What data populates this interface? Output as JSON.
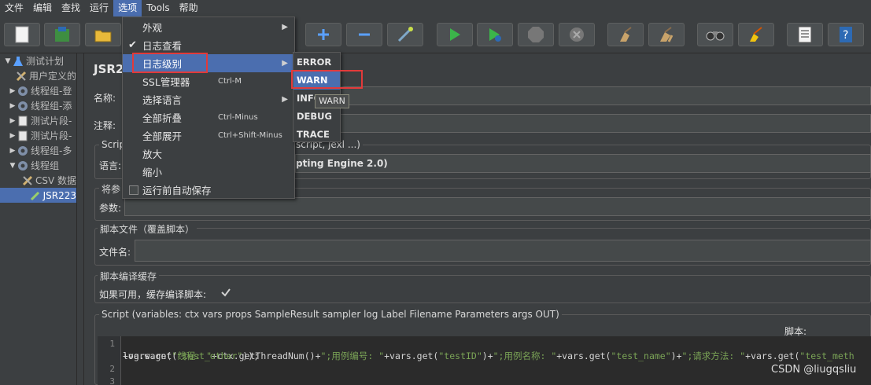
{
  "menubar": {
    "items": [
      "文件",
      "编辑",
      "查找",
      "运行",
      "选项",
      "Tools",
      "帮助"
    ]
  },
  "dropdown": {
    "items": [
      {
        "label": "外观",
        "shortcut": "",
        "submenu": true,
        "check": false
      },
      {
        "label": "日志查看",
        "shortcut": "",
        "submenu": false,
        "check": true
      },
      {
        "label": "日志级别",
        "shortcut": "",
        "submenu": true,
        "check": false
      },
      {
        "label": "SSL管理器",
        "shortcut": "Ctrl-M",
        "submenu": false,
        "check": false
      },
      {
        "label": "选择语言",
        "shortcut": "",
        "submenu": true,
        "check": false
      },
      {
        "label": "全部折叠",
        "shortcut": "Ctrl-Minus",
        "submenu": false,
        "check": false
      },
      {
        "label": "全部展开",
        "shortcut": "Ctrl+Shift-Minus",
        "submenu": false,
        "check": false
      },
      {
        "label": "放大",
        "shortcut": "",
        "submenu": false,
        "check": false
      },
      {
        "label": "缩小",
        "shortcut": "",
        "submenu": false,
        "check": false
      },
      {
        "label": "运行前自动保存",
        "shortcut": "",
        "submenu": false,
        "check": false
      }
    ]
  },
  "submenu": {
    "items": [
      "ERROR",
      "WARN",
      "INFO",
      "DEBUG",
      "TRACE"
    ],
    "tooltip": "WARN"
  },
  "tree": {
    "items": [
      {
        "label": "测试计划",
        "arrow": "▼",
        "icon": "flask"
      },
      {
        "label": "用户定义的",
        "arrow": "",
        "icon": "tools"
      },
      {
        "label": "线程组-登",
        "arrow": "▶",
        "icon": "gear"
      },
      {
        "label": "线程组-添",
        "arrow": "▶",
        "icon": "gear"
      },
      {
        "label": "测试片段-",
        "arrow": "▶",
        "icon": "doc"
      },
      {
        "label": "测试片段-",
        "arrow": "▶",
        "icon": "doc"
      },
      {
        "label": "线程组-多",
        "arrow": "▶",
        "icon": "gear"
      },
      {
        "label": "线程组",
        "arrow": "▼",
        "icon": "gear"
      },
      {
        "label": "CSV 数据",
        "arrow": "",
        "icon": "tools"
      },
      {
        "label": "JSR223",
        "arrow": "",
        "icon": "pen"
      }
    ]
  },
  "main": {
    "title": "JSR2",
    "name_label": "名称:",
    "comment_label": "注释:",
    "script_group_title": "Scrip",
    "script_group_title_right": "script, jexl ...)",
    "language_label": "语言:",
    "language_value": "pting Engine 2.0)",
    "params_group_title": "将参",
    "params_label": "参数:",
    "file_group_title": "脚本文件（覆盖脚本）",
    "file_label": "文件名:",
    "cache_group_title": "脚本编译缓存",
    "cache_label": "如果可用，缓存编译脚本:",
    "script_section_title": "Script (variables: ctx vars props SampleResult sampler log Label Filename Parameters args OUT)",
    "script_label": "脚本:"
  },
  "editor": {
    "line_numbers": [
      "1",
      "",
      "2",
      "3"
    ],
    "line1_parts": [
      "log.warn(",
      "\"线程: \"",
      "+ctx.getThreadNum()+",
      "\";用例编号: \"",
      "+vars.get(",
      "\"testID\"",
      ")+",
      "\";用例名称: \"",
      "+vars.get(",
      "\"test_name\"",
      ")+",
      "\";请求方法: \"",
      "+vars.get(",
      "\"test_meth"
    ],
    "line1b_parts": [
      "+vars.get(",
      "\"test_other\"",
      "));"
    ]
  },
  "watermark": "CSDN @liugqsliu",
  "colors": {
    "highlight": "#4b6eaf",
    "annotation": "#e23a3a",
    "background": "#3c3f41"
  }
}
